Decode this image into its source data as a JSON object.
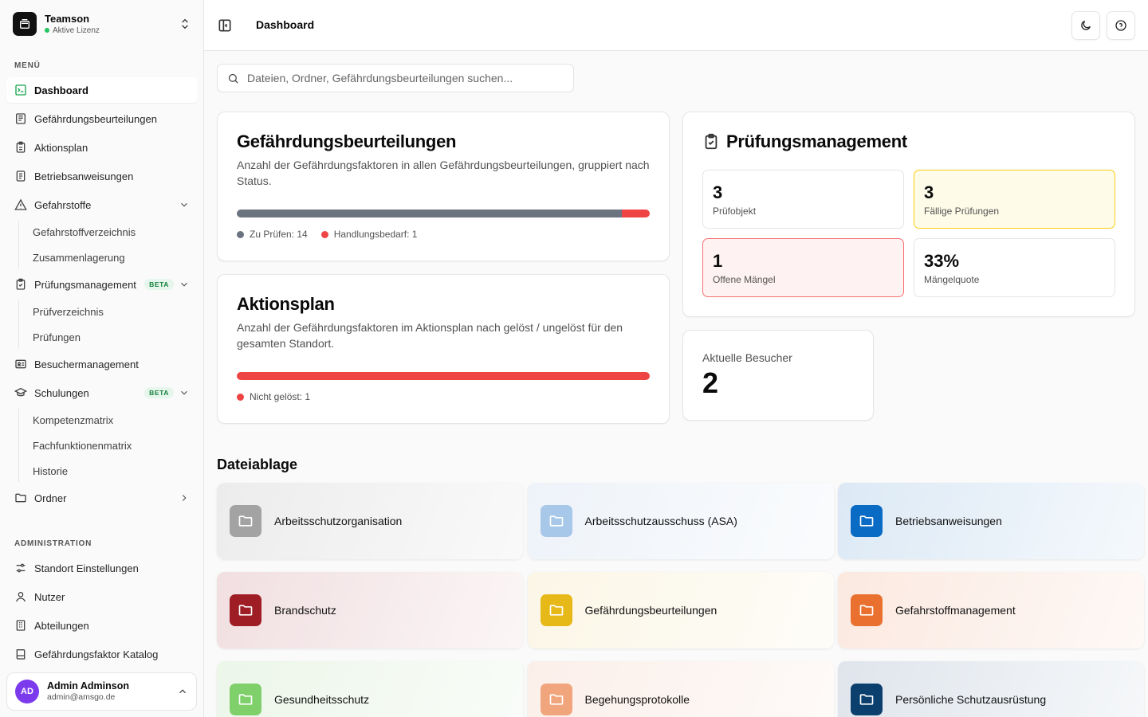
{
  "brand": {
    "name": "Teamson",
    "license": "Aktive Lizenz"
  },
  "sidebar": {
    "menu_label": "MENÜ",
    "items": [
      {
        "label": "Dashboard"
      },
      {
        "label": "Gefährdungsbeurteilungen"
      },
      {
        "label": "Aktionsplan"
      },
      {
        "label": "Betriebsanweisungen"
      },
      {
        "label": "Gefahrstoffe",
        "sub": [
          "Gefahrstoffverzeichnis",
          "Zusammenlagerung"
        ]
      },
      {
        "label": "Prüfungsmanagement",
        "badge": "BETA",
        "sub": [
          "Prüfverzeichnis",
          "Prüfungen"
        ]
      },
      {
        "label": "Besuchermanagement"
      },
      {
        "label": "Schulungen",
        "badge": "BETA",
        "sub": [
          "Kompetenzmatrix",
          "Fachfunktionenmatrix",
          "Historie"
        ]
      },
      {
        "label": "Ordner"
      }
    ],
    "admin_label": "ADMINISTRATION",
    "admin_items": [
      {
        "label": "Standort Einstellungen"
      },
      {
        "label": "Nutzer"
      },
      {
        "label": "Abteilungen"
      },
      {
        "label": "Gefährdungsfaktor Katalog"
      }
    ]
  },
  "user": {
    "initials": "AD",
    "name": "Admin Adminson",
    "email": "admin@amsgo.de",
    "avatar_color": "#7c3aed"
  },
  "header": {
    "title": "Dashboard"
  },
  "search": {
    "placeholder": "Dateien, Ordner, Gefährdungsbeurteilungen suchen..."
  },
  "gb_card": {
    "title": "Gefährdungsbeurteilungen",
    "desc": "Anzahl der Gefährdungsfaktoren in allen Gefährdungsbeurteilungen, gruppiert nach Status.",
    "segments": [
      {
        "label": "Zu Prüfen: 14",
        "value": 14,
        "color": "#6b7280"
      },
      {
        "label": "Handlungsbedarf: 1",
        "value": 1,
        "color": "#ef4444"
      }
    ]
  },
  "ap_card": {
    "title": "Aktionsplan",
    "desc": "Anzahl der Gefährdungsfaktoren im Aktionsplan nach gelöst / ungelöst für den gesamten Standort.",
    "segments": [
      {
        "label": "Nicht gelöst: 1",
        "value": 1,
        "color": "#ef4444"
      }
    ]
  },
  "pm_card": {
    "title": "Prüfungsmanagement",
    "stats": [
      {
        "num": "3",
        "label": "Prüfobjekt"
      },
      {
        "num": "3",
        "label": "Fällige Prüfungen"
      },
      {
        "num": "1",
        "label": "Offene Mängel"
      },
      {
        "num": "33%",
        "label": "Mängelquote"
      }
    ]
  },
  "visitors": {
    "label": "Aktuelle Besucher",
    "count": "2"
  },
  "files": {
    "title": "Dateiablage",
    "folders": [
      {
        "name": "Arbeitsschutzorganisation",
        "color": "#a3a3a3",
        "bg": "#ececec"
      },
      {
        "name": "Arbeitsschutzausschuss (ASA)",
        "color": "#a8c8ea",
        "bg": "#eef3f9"
      },
      {
        "name": "Betriebsanweisungen",
        "color": "#0a6bc4",
        "bg": "#dce9f5"
      },
      {
        "name": "Brandschutz",
        "color": "#9f1d25",
        "bg": "#f1dfe1"
      },
      {
        "name": "Gefährdungsbeurteilungen",
        "color": "#e6b919",
        "bg": "#fbf6e6"
      },
      {
        "name": "Gefahrstoffmanagement",
        "color": "#ea7030",
        "bg": "#fbe9e0"
      },
      {
        "name": "Gesundheitsschutz",
        "color": "#7fcf6a",
        "bg": "#ecf6e9"
      },
      {
        "name": "Begehungsprotokolle",
        "color": "#f0a57d",
        "bg": "#fbefe9"
      },
      {
        "name": "Persönliche Schutzausrüstung",
        "color": "#0b3f6d",
        "bg": "#dfe5ec"
      }
    ]
  }
}
